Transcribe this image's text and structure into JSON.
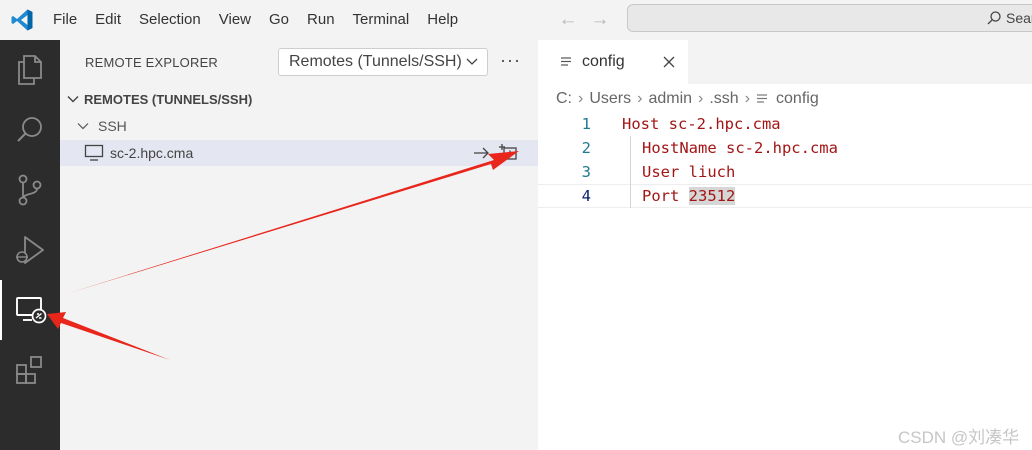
{
  "menu": [
    "File",
    "Edit",
    "Selection",
    "View",
    "Go",
    "Run",
    "Terminal",
    "Help"
  ],
  "search": {
    "label": "Search"
  },
  "activity_bar": {
    "items": [
      "explorer",
      "search",
      "source-control",
      "run-and-debug",
      "remote-explorer",
      "extensions"
    ],
    "active": "remote-explorer"
  },
  "sidebar": {
    "title": "REMOTE EXPLORER",
    "dropdown_value": "Remotes (Tunnels/SSH)",
    "section_header": "REMOTES (TUNNELS/SSH)",
    "group": "SSH",
    "host": "sc-2.hpc.cma"
  },
  "editor": {
    "tab_label": "config",
    "breadcrumb": [
      "C:",
      "Users",
      "admin",
      ".ssh",
      "config"
    ],
    "lines": [
      {
        "number": "1",
        "text": "Host sc-2.hpc.cma"
      },
      {
        "number": "2",
        "text": "HostName sc-2.hpc.cma"
      },
      {
        "number": "3",
        "text": "User liuch"
      },
      {
        "number": "4",
        "text": "Port ",
        "highlight": "23512"
      }
    ]
  },
  "watermark": "CSDN @刘凑华",
  "colors": {
    "activity_bar_bg": "#2c2c2c",
    "keyword_red": "#a31515",
    "annotation_arrow": "#e8261c",
    "line_number": "#237893"
  }
}
